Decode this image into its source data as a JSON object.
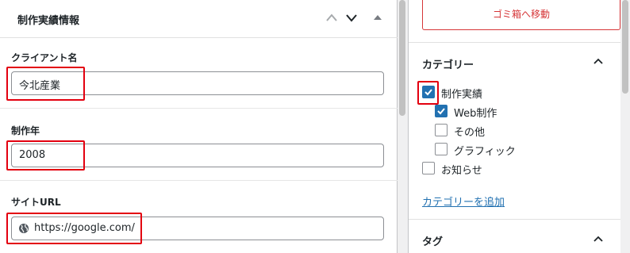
{
  "meta_box": {
    "title": "制作実績情報"
  },
  "fields": [
    {
      "label": "クライアント名",
      "value": "今北産業"
    },
    {
      "label": "制作年",
      "value": "2008"
    },
    {
      "label": "サイトURL",
      "value": "https://google.com/"
    }
  ],
  "sidebar": {
    "trash_label": "ゴミ箱へ移動",
    "categories_title": "カテゴリー",
    "categories": [
      {
        "label": "制作実績",
        "checked": true
      },
      {
        "label": "Web制作",
        "checked": true
      },
      {
        "label": "その他",
        "checked": false
      },
      {
        "label": "グラフィック",
        "checked": false
      },
      {
        "label": "お知らせ",
        "checked": false
      }
    ],
    "add_category_label": "カテゴリーを追加",
    "tags_title": "タグ"
  },
  "colors": {
    "accent": "#2271b1",
    "highlight": "#e3000f",
    "danger": "#d63638"
  }
}
